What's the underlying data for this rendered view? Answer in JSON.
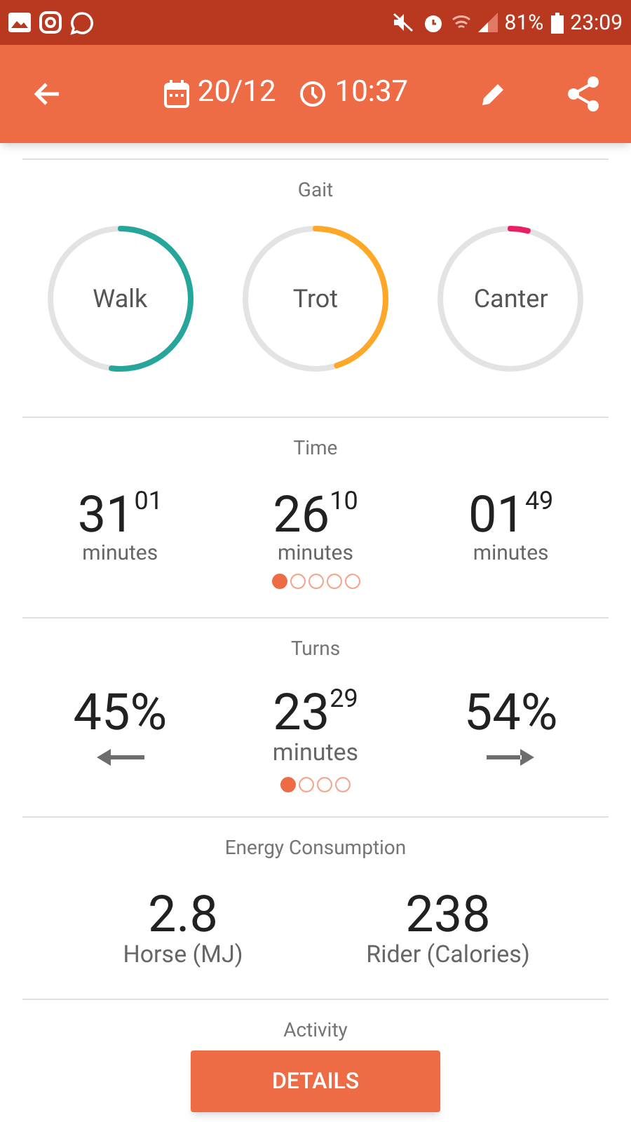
{
  "status_bar": {
    "battery": "81%",
    "time": "23:09"
  },
  "app_bar": {
    "date": "20/12",
    "time": "10:37"
  },
  "gait": {
    "title": "Gait",
    "items": [
      {
        "label": "Walk",
        "color": "#26a69a"
      },
      {
        "label": "Trot",
        "color": "#ffa726"
      },
      {
        "label": "Canter",
        "color": "#e91e63"
      }
    ]
  },
  "time": {
    "title": "Time",
    "items": [
      {
        "value": "31$^{01}$",
        "unit": "minutes"
      },
      {
        "value": "26$^{10}$",
        "unit": "minutes"
      },
      {
        "value": "01$^{49}$",
        "unit": "minutes"
      }
    ],
    "pager": [
      {
        "selected": true
      },
      {
        "selected": false
      },
      {
        "selected": false
      },
      {
        "selected": false
      },
      {
        "selected": false
      }
    ]
  },
  "turns": {
    "title": "Turns",
    "left": {
      "value": "45%"
    },
    "center": {
      "value": "23$^{29}$",
      "unit": "minutes"
    },
    "right": {
      "value": "54%"
    },
    "pager": [
      {
        "selected": true
      },
      {
        "selected": false
      },
      {
        "selected": false
      },
      {
        "selected": false
      }
    ]
  },
  "energy": {
    "title": "Energy Consumption",
    "items": [
      {
        "value": "2.8",
        "label": "Horse (MJ)"
      },
      {
        "value": "238",
        "label": "Rider (Calories)"
      }
    ]
  },
  "activity": {
    "title": "Activity",
    "button": "DETAILS"
  }
}
